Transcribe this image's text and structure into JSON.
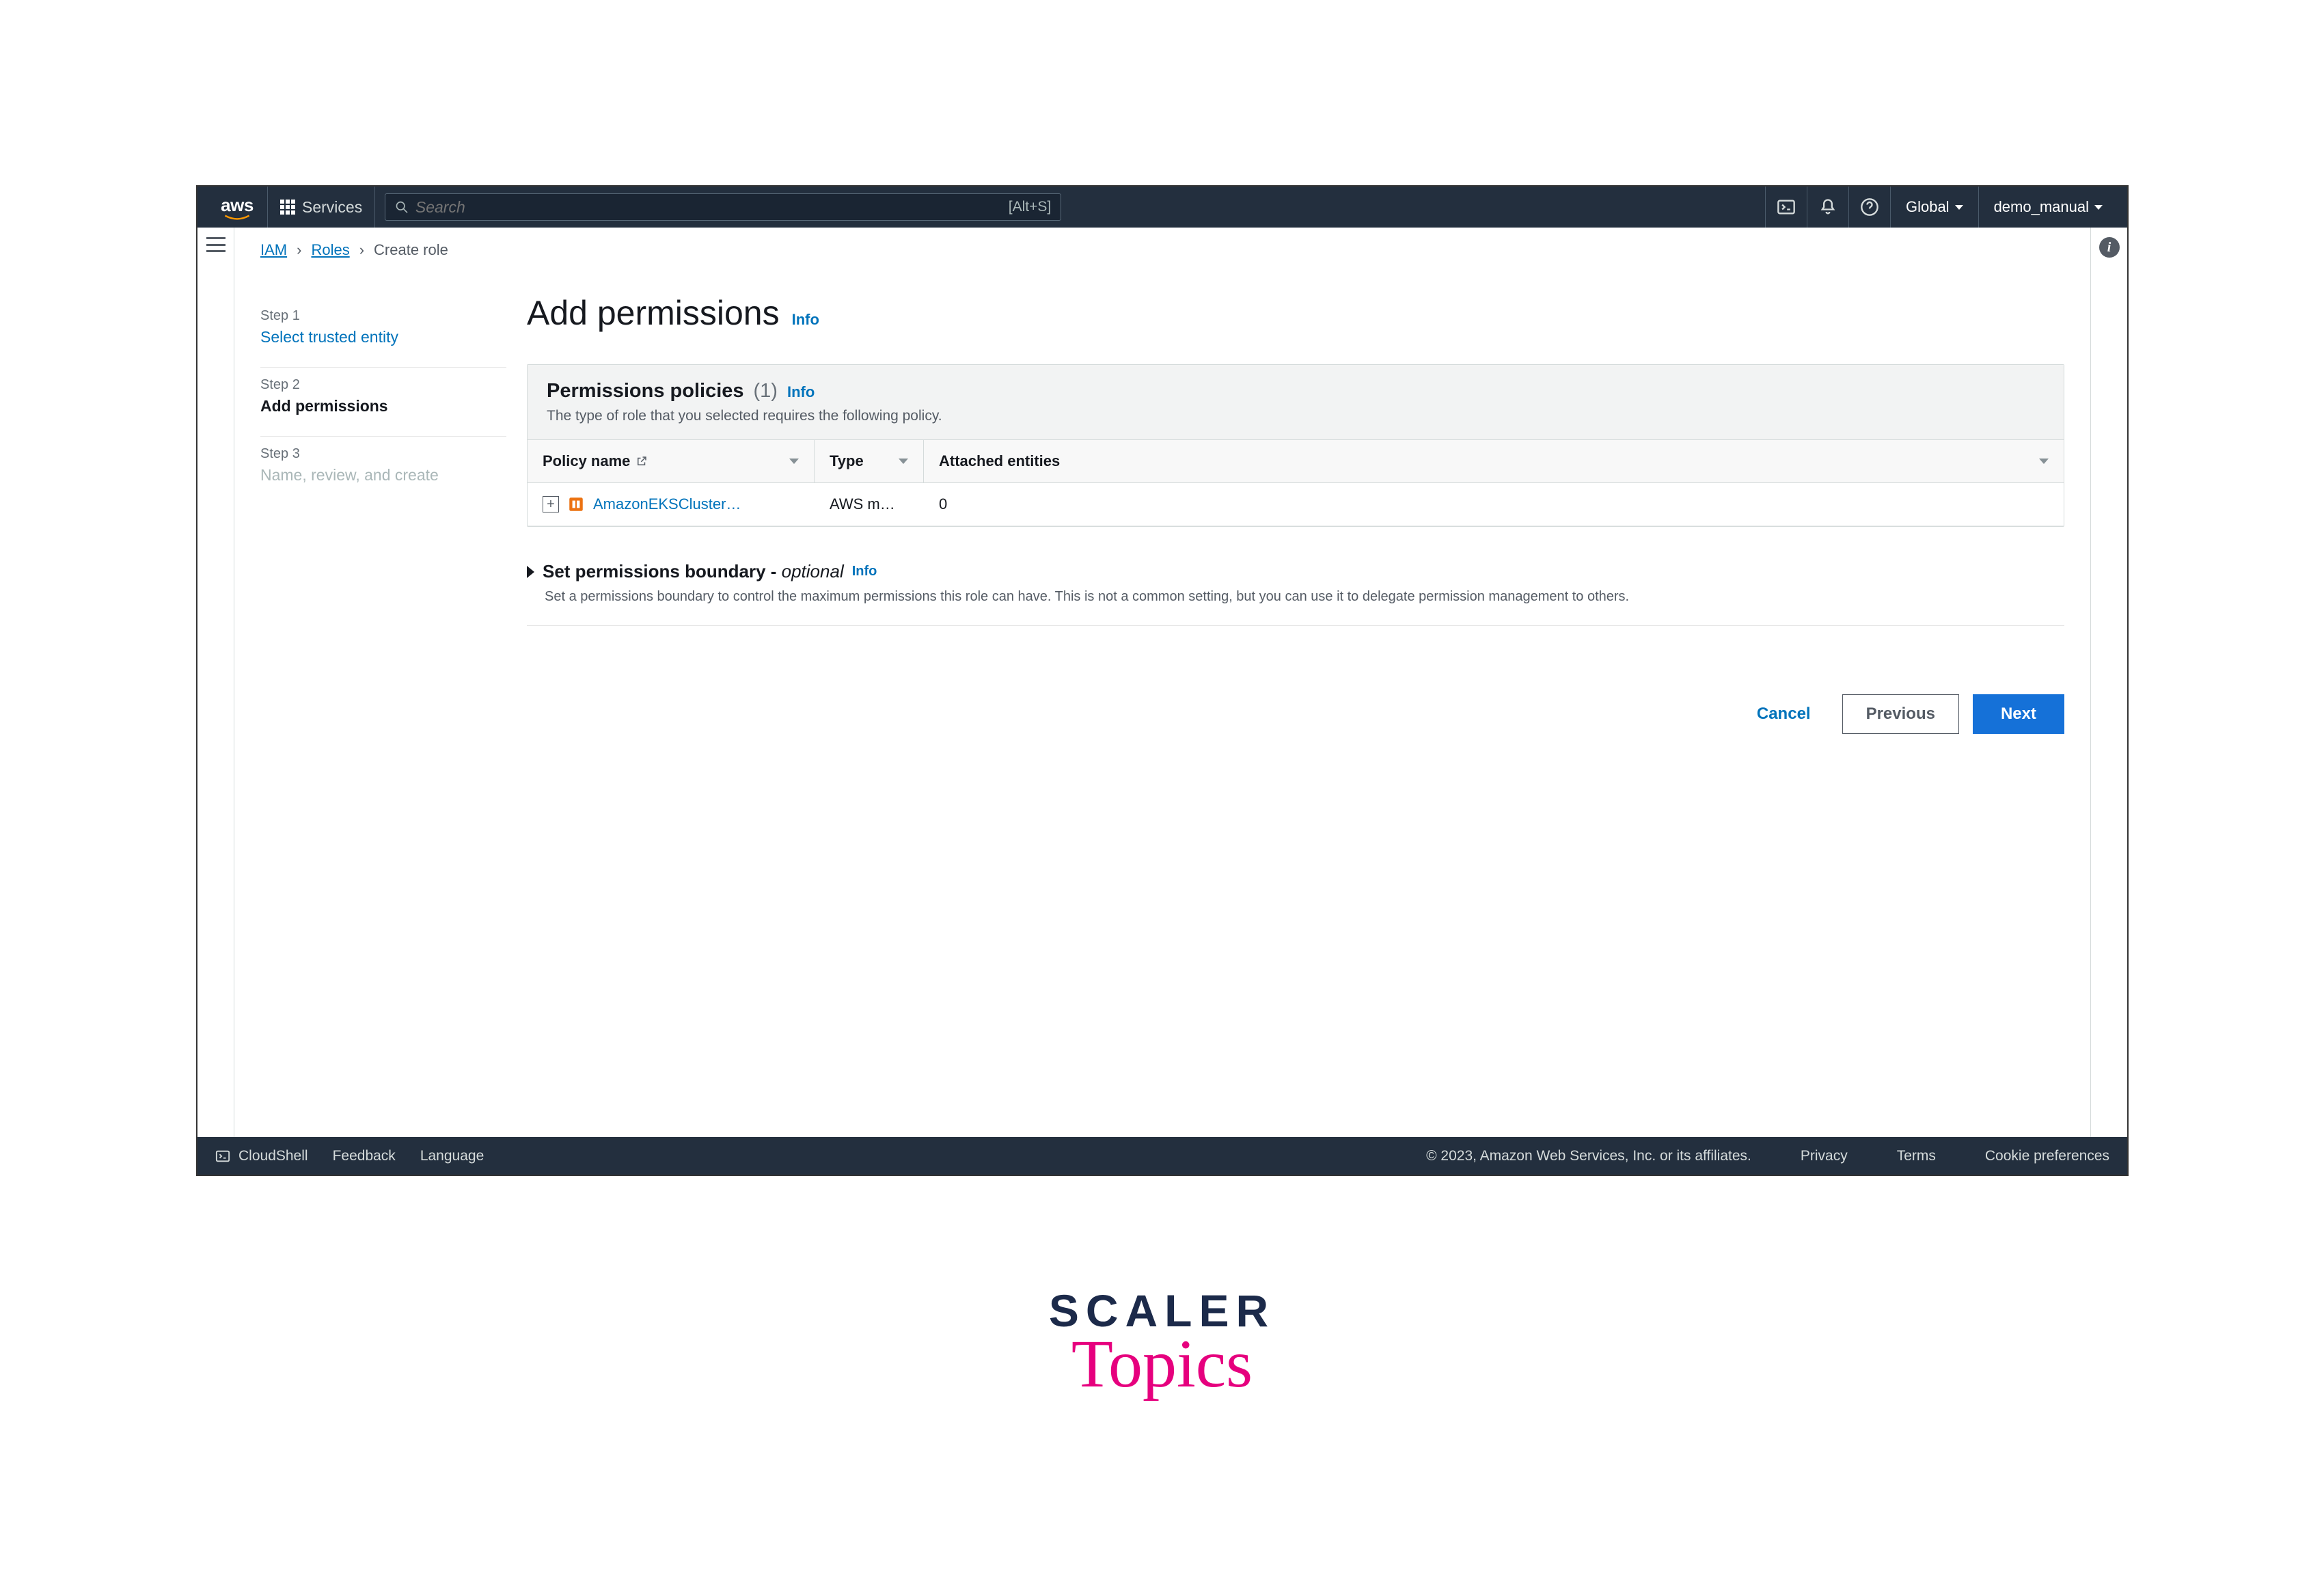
{
  "topnav": {
    "services_label": "Services",
    "search_placeholder": "Search",
    "search_shortcut": "[Alt+S]",
    "region_label": "Global",
    "account_label": "demo_manual"
  },
  "breadcrumb": {
    "iam": "IAM",
    "roles": "Roles",
    "current": "Create role"
  },
  "wizard": {
    "step1_label": "Step 1",
    "step1_title": "Select trusted entity",
    "step2_label": "Step 2",
    "step2_title": "Add permissions",
    "step3_label": "Step 3",
    "step3_title": "Name, review, and create"
  },
  "page": {
    "h1": "Add permissions",
    "h1_info": "Info"
  },
  "policies_panel": {
    "title": "Permissions policies",
    "count": "(1)",
    "info": "Info",
    "desc": "The type of role that you selected requires the following policy.",
    "col_policy": "Policy name",
    "col_type": "Type",
    "col_entities": "Attached entities",
    "row": {
      "name": "AmazonEKSCluster…",
      "type": "AWS m…",
      "entities": "0"
    }
  },
  "boundary": {
    "title_bold": "Set permissions boundary - ",
    "title_opt": "optional",
    "info": "Info",
    "desc": "Set a permissions boundary to control the maximum permissions this role can have. This is not a common setting, but you can use it to delegate permission management to others."
  },
  "actions": {
    "cancel": "Cancel",
    "previous": "Previous",
    "next": "Next"
  },
  "bottombar": {
    "cloudshell": "CloudShell",
    "feedback": "Feedback",
    "language": "Language",
    "copyright": "© 2023, Amazon Web Services, Inc. or its affiliates.",
    "privacy": "Privacy",
    "terms": "Terms",
    "cookies": "Cookie preferences"
  },
  "watermark": {
    "line1": "SCALER",
    "line2": "Topics"
  }
}
